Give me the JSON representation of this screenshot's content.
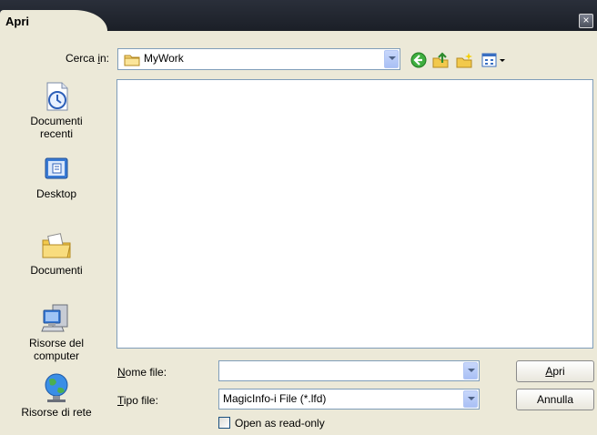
{
  "window": {
    "title": "Apri",
    "close_label": "×"
  },
  "look_in": {
    "label_prefix": "Cerca ",
    "label_mnemonic": "i",
    "label_suffix": "n:",
    "value": "MyWork"
  },
  "toolbar": {
    "icons": [
      "back-icon",
      "up-folder-icon",
      "new-folder-icon",
      "view-menu-icon"
    ]
  },
  "places": [
    {
      "label": "Documenti recenti",
      "icon": "recent-documents-icon"
    },
    {
      "label": "Desktop",
      "icon": "desktop-icon"
    },
    {
      "label": "Documenti",
      "icon": "documents-icon"
    },
    {
      "label": "Risorse del computer",
      "icon": "my-computer-icon"
    },
    {
      "label": "Risorse di rete",
      "icon": "network-icon"
    }
  ],
  "file_name": {
    "mnemonic": "N",
    "label_rest": "ome file:",
    "value": ""
  },
  "file_type": {
    "mnemonic": "T",
    "label_rest": "ipo file:",
    "value": "MagicInfo-i File (*.lfd)"
  },
  "read_only": {
    "label": "Open as read-only",
    "checked": false
  },
  "buttons": {
    "open_mnemonic": "A",
    "open_rest": "pri",
    "cancel": "Annulla"
  }
}
